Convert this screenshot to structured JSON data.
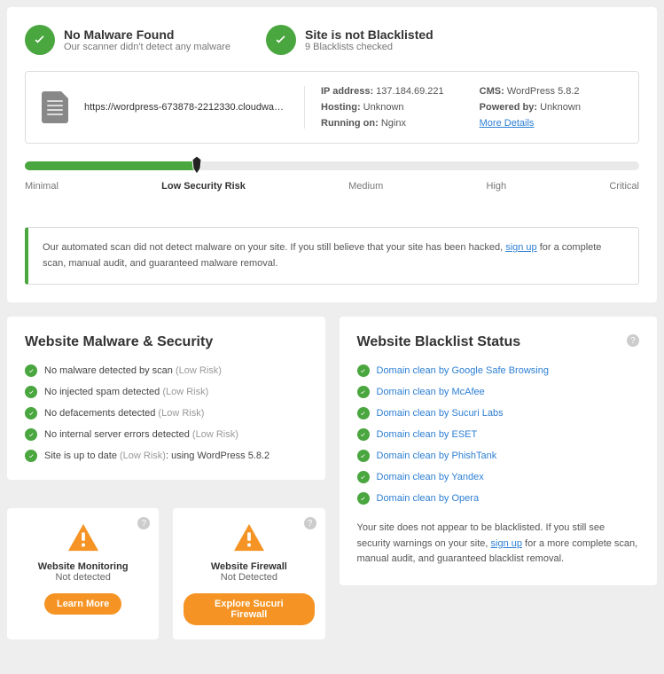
{
  "header": {
    "malware": {
      "title": "No Malware Found",
      "subtitle": "Our scanner didn't detect any malware"
    },
    "blacklist": {
      "title": "Site is not Blacklisted",
      "subtitle": "9 Blacklists checked"
    }
  },
  "site": {
    "url": "https://wordpress-673878-2212330.cloudwaysa...",
    "ip_label": "IP address:",
    "ip": "137.184.69.221",
    "hosting_label": "Hosting:",
    "hosting": "Unknown",
    "running_label": "Running on:",
    "running": "Nginx",
    "cms_label": "CMS:",
    "cms": "WordPress 5.8.2",
    "powered_label": "Powered by:",
    "powered": "Unknown",
    "more_details": "More Details"
  },
  "risk": {
    "levels": [
      "Minimal",
      "Low Security Risk",
      "Medium",
      "High",
      "Critical"
    ],
    "active_index": 1,
    "percent": 28
  },
  "note": {
    "prefix": "Our automated scan did not detect malware on your site. If you still believe that your site has been hacked, ",
    "link": "sign up",
    "suffix": " for a complete scan, manual audit, and guaranteed malware removal."
  },
  "security": {
    "title": "Website Malware & Security",
    "items": [
      {
        "text": "No malware detected by scan",
        "risk": "(Low Risk)"
      },
      {
        "text": "No injected spam detected",
        "risk": "(Low Risk)"
      },
      {
        "text": "No defacements detected",
        "risk": "(Low Risk)"
      },
      {
        "text": "No internal server errors detected",
        "risk": "(Low Risk)"
      },
      {
        "text": "Site is up to date",
        "risk": "(Low Risk)",
        "extra": ": using WordPress 5.8.2"
      }
    ]
  },
  "blacklist": {
    "title": "Website Blacklist Status",
    "items": [
      "Domain clean by Google Safe Browsing",
      "Domain clean by McAfee",
      "Domain clean by Sucuri Labs",
      "Domain clean by ESET",
      "Domain clean by PhishTank",
      "Domain clean by Yandex",
      "Domain clean by Opera"
    ],
    "desc_prefix": "Your site does not appear to be blacklisted. If you still see security warnings on your site, ",
    "desc_link": "sign up",
    "desc_suffix": " for a more complete scan, manual audit, and guaranteed blacklist removal."
  },
  "mini": {
    "monitoring": {
      "title": "Website Monitoring",
      "sub": "Not detected",
      "btn": "Learn More"
    },
    "firewall": {
      "title": "Website Firewall",
      "sub": "Not Detected",
      "btn": "Explore Sucuri Firewall"
    }
  }
}
